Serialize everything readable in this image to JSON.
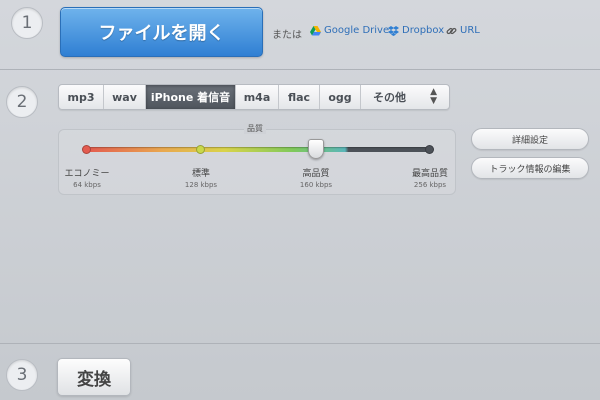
{
  "steps": {
    "one": "1",
    "two": "2",
    "three": "3"
  },
  "open": {
    "button_label": "ファイルを開く",
    "or_text": "または",
    "sources": [
      {
        "label": "Google Drive",
        "icon": "google-drive-icon"
      },
      {
        "label": "Dropbox",
        "icon": "dropbox-icon"
      },
      {
        "label": "URL",
        "icon": "link-icon"
      }
    ]
  },
  "formats": {
    "items": [
      "mp3",
      "wav",
      "iPhone 着信音",
      "m4a",
      "flac",
      "ogg"
    ],
    "selected": "iPhone 着信音",
    "other_label": "その他",
    "other_icon": "updown-arrows-icon"
  },
  "quality": {
    "title": "品質",
    "selected_index": 2,
    "levels": [
      {
        "label": "エコノミー",
        "bitrate": "64 kbps",
        "color": "#e35b4f"
      },
      {
        "label": "標準",
        "bitrate": "128 kbps",
        "color": "#c9d84a"
      },
      {
        "label": "高品質",
        "bitrate": "160 kbps",
        "color": "#5ab6b9"
      },
      {
        "label": "最高品質",
        "bitrate": "256 kbps",
        "color": "#4c5158"
      }
    ]
  },
  "side_buttons": {
    "advanced": "詳細設定",
    "track_info": "トラック情報の編集"
  },
  "convert": {
    "label": "変換"
  },
  "colors": {
    "accent": "#2f7fd3",
    "link": "#2f6fb8",
    "active_tab": "#555b63"
  }
}
